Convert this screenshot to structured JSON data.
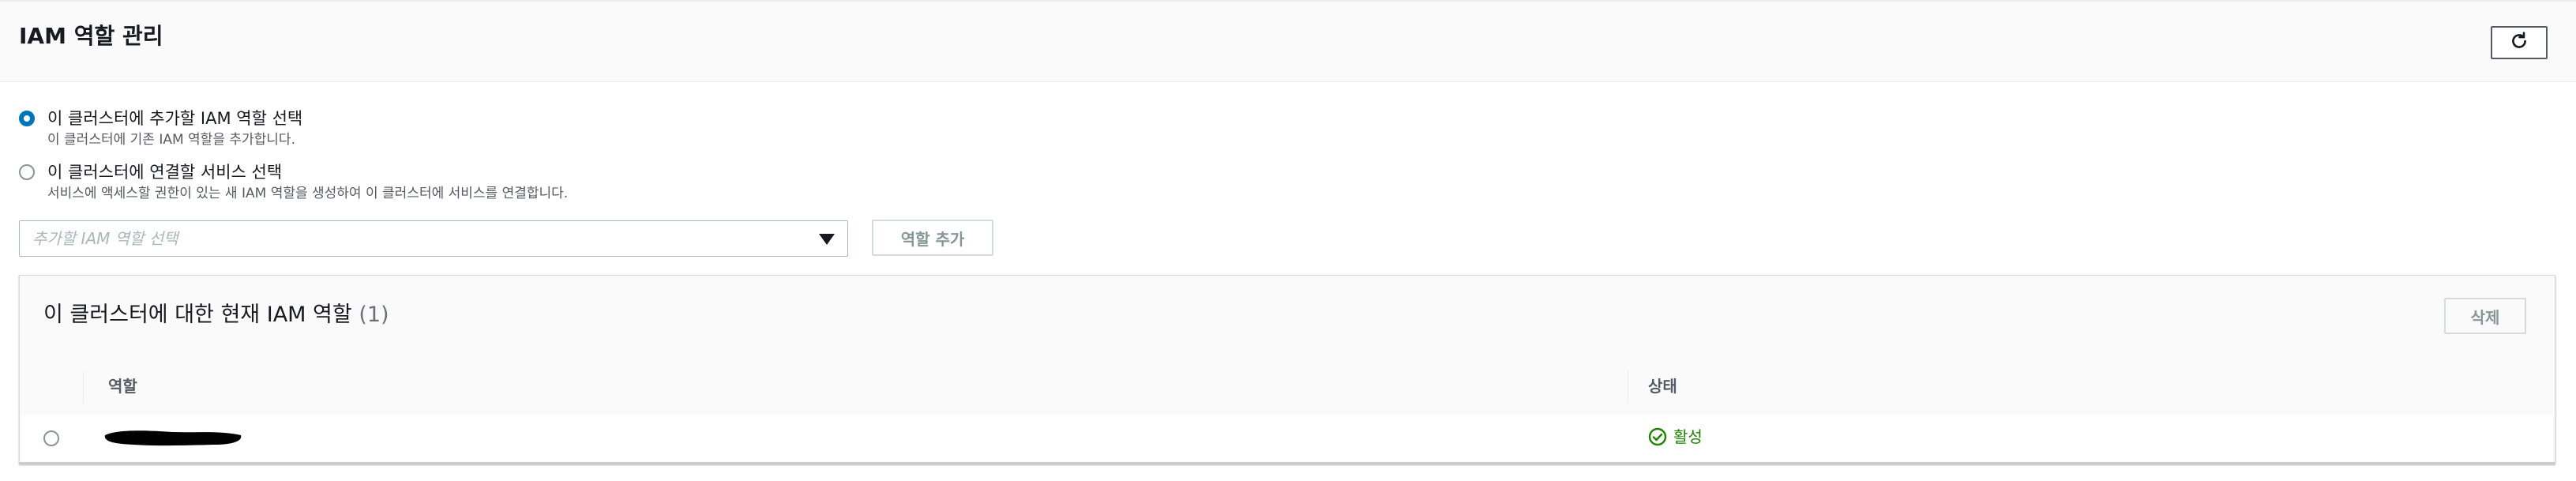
{
  "header": {
    "title": "IAM 역할 관리",
    "refresh_icon": "refresh-icon"
  },
  "options": [
    {
      "label": "이 클러스터에 추가할 IAM 역할 선택",
      "description": "이 클러스터에 기존 IAM 역할을 추가합니다.",
      "selected": true
    },
    {
      "label": "이 클러스터에 연결할 서비스 선택",
      "description": "서비스에 액세스할 권한이 있는 새 IAM 역할을 생성하여 이 클러스터에 서비스를 연결합니다.",
      "selected": false
    }
  ],
  "role_select": {
    "placeholder": "추가할 IAM 역할 선택",
    "caret_icon": "caret-down-icon"
  },
  "add_role_button": "역할 추가",
  "table": {
    "title": "이 클러스터에 대한 현재 IAM 역할",
    "count": "(1)",
    "delete_button": "삭제",
    "columns": [
      "역할",
      "상태"
    ],
    "rows": [
      {
        "role": "",
        "status": "활성",
        "status_icon": "check-circle-icon"
      }
    ]
  },
  "colors": {
    "accent": "#0073bb",
    "success": "#1d8102",
    "border": "#aab7b8",
    "header_bg": "#fafafa"
  }
}
